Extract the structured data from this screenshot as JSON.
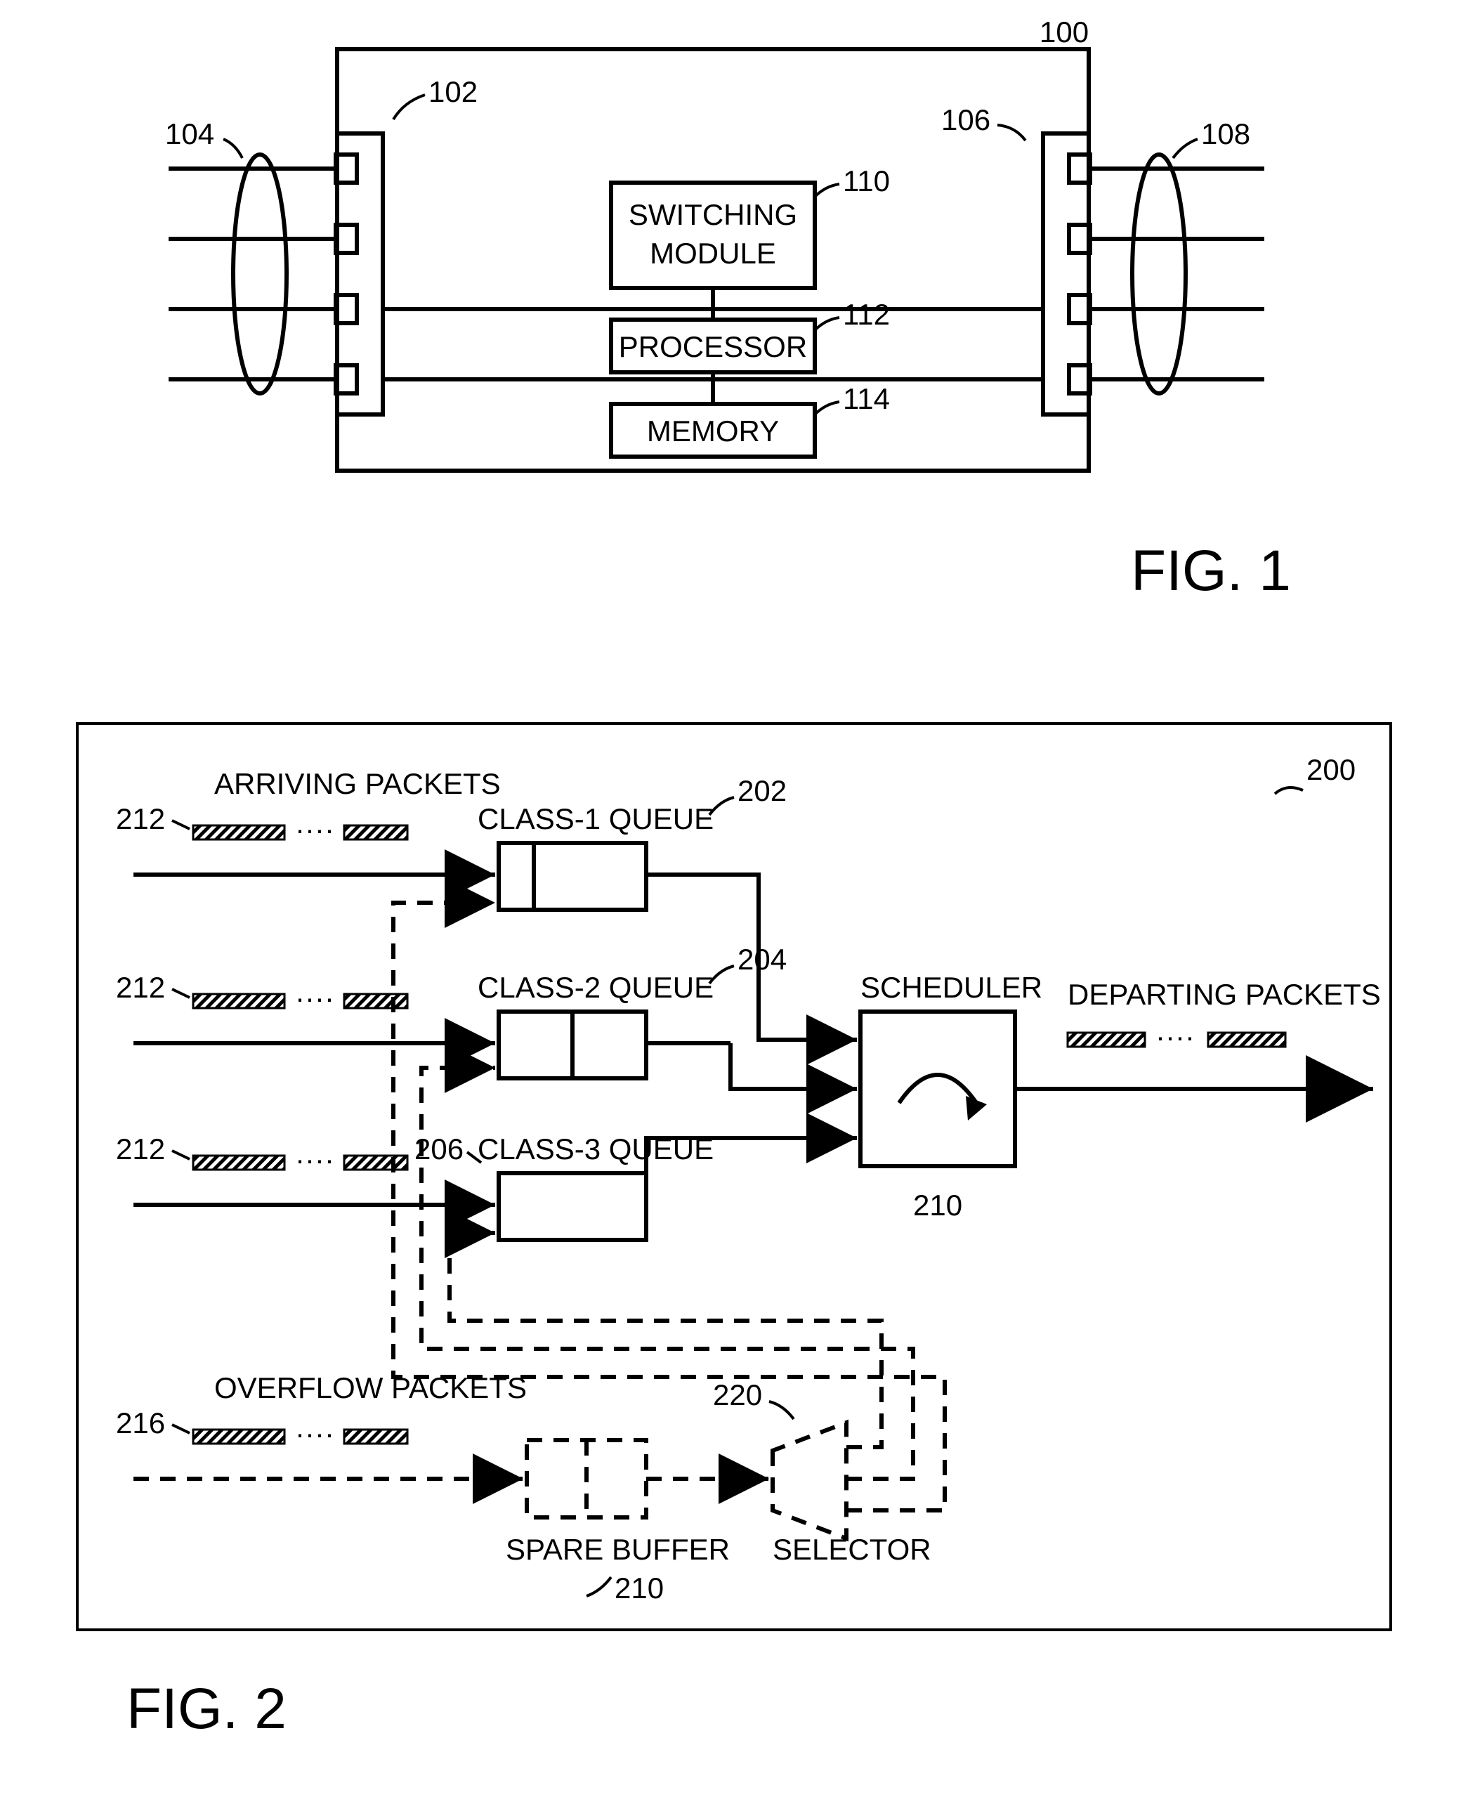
{
  "fig1": {
    "caption": "FIG. 1",
    "refs": {
      "device": "100",
      "inputPortColumn": "102",
      "inputLinks": "104",
      "outputPortColumn": "106",
      "outputLinks": "108",
      "switching": "110",
      "switchingLabel": "SWITCHING\nMODULE",
      "processor": "112",
      "processorLabel": "PROCESSOR",
      "memory": "114",
      "memoryLabel": "MEMORY"
    }
  },
  "fig2": {
    "caption": "FIG. 2",
    "refs": {
      "system": "200",
      "arriving": "ARRIVING PACKETS",
      "arrivingRef": "212",
      "q1": "CLASS-1 QUEUE",
      "q1ref": "202",
      "q2": "CLASS-2 QUEUE",
      "q2ref": "204",
      "q3": "CLASS-3 QUEUE",
      "q3ref": "206",
      "scheduler": "SCHEDULER",
      "schedulerRef": "210",
      "departing": "DEPARTING PACKETS",
      "overflow": "OVERFLOW PACKETS",
      "overflowRef": "216",
      "spareBuffer": "SPARE BUFFER",
      "spareBufferRef": "210",
      "selector": "SELECTOR",
      "selectorRef": "220"
    }
  }
}
